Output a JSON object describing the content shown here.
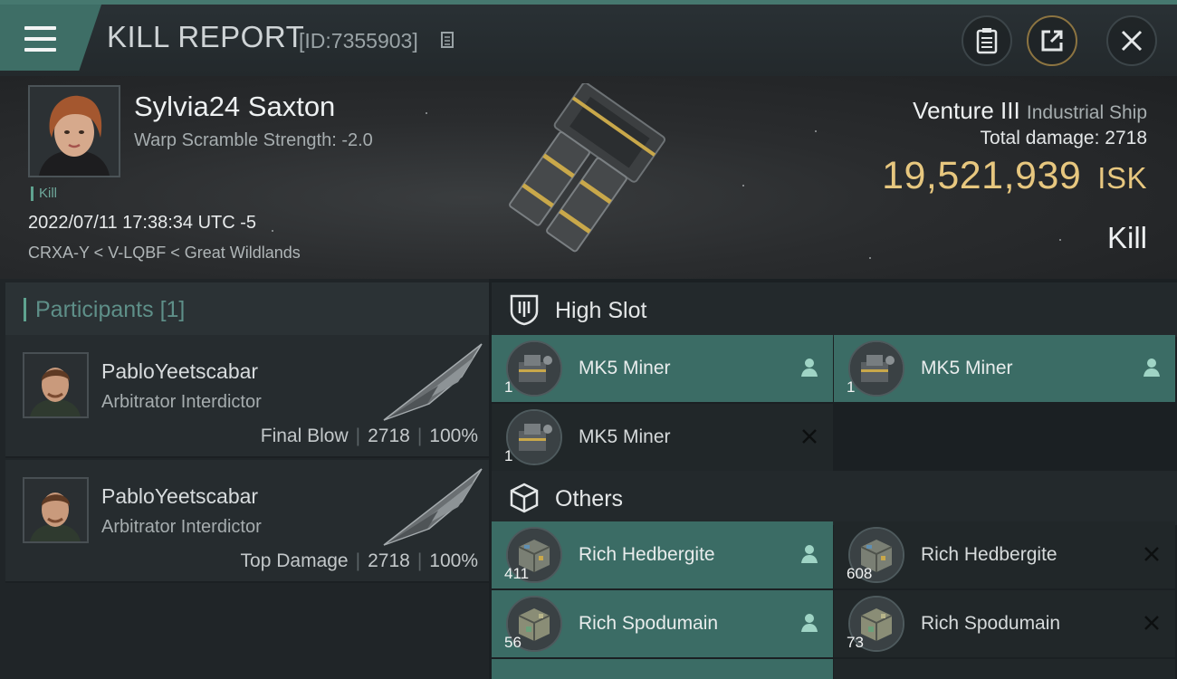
{
  "header": {
    "title": "KILL REPORT",
    "report_id": "[ID:7355903]"
  },
  "victim": {
    "name": "Sylvia24 Saxton",
    "warp_scramble": "Warp Scramble Strength: -2.0",
    "tag": "Kill",
    "datetime": "2022/07/11 17:38:34 UTC -5",
    "location": "CRXA-Y < V-LQBF < Great Wildlands",
    "ship_name": "Venture III",
    "ship_class": "Industrial Ship",
    "total_damage_label": "Total damage:",
    "total_damage": "2718",
    "isk_value": "19,521,939",
    "isk_unit": "ISK",
    "result": "Kill"
  },
  "participants": {
    "title": "Participants",
    "count": "[1]",
    "rows": [
      {
        "name": "PabloYeetscabar",
        "ship": "Arbitrator Interdictor",
        "role": "Final Blow",
        "damage": "2718",
        "percent": "100%"
      },
      {
        "name": "PabloYeetscabar",
        "ship": "Arbitrator Interdictor",
        "role": "Top Damage",
        "damage": "2718",
        "percent": "100%"
      }
    ]
  },
  "sections": {
    "high_slot": "High Slot",
    "others": "Others"
  },
  "items": {
    "high_slot": [
      {
        "name": "MK5 Miner",
        "qty": "1",
        "status": "dropped"
      },
      {
        "name": "MK5 Miner",
        "qty": "1",
        "status": "dropped"
      },
      {
        "name": "MK5 Miner",
        "qty": "1",
        "status": "destroyed"
      }
    ],
    "others": [
      {
        "name": "Rich Hedbergite",
        "qty": "411",
        "status": "dropped"
      },
      {
        "name": "Rich Hedbergite",
        "qty": "608",
        "status": "destroyed"
      },
      {
        "name": "Rich Spodumain",
        "qty": "56",
        "status": "dropped"
      },
      {
        "name": "Rich Spodumain",
        "qty": "73",
        "status": "destroyed"
      }
    ]
  },
  "colors": {
    "accent_teal": "#3e6e66",
    "isk_gold": "#e7c77f",
    "dropped_item": "#3b6c65"
  },
  "icons": {
    "menu": "hamburger-menu-icon",
    "copy": "copy-icon",
    "clipboard": "clipboard-icon",
    "share": "share-icon",
    "close": "close-icon",
    "high_slot": "high-slot-icon",
    "others": "cube-icon",
    "dropped": "person-icon",
    "destroyed": "x-icon"
  }
}
